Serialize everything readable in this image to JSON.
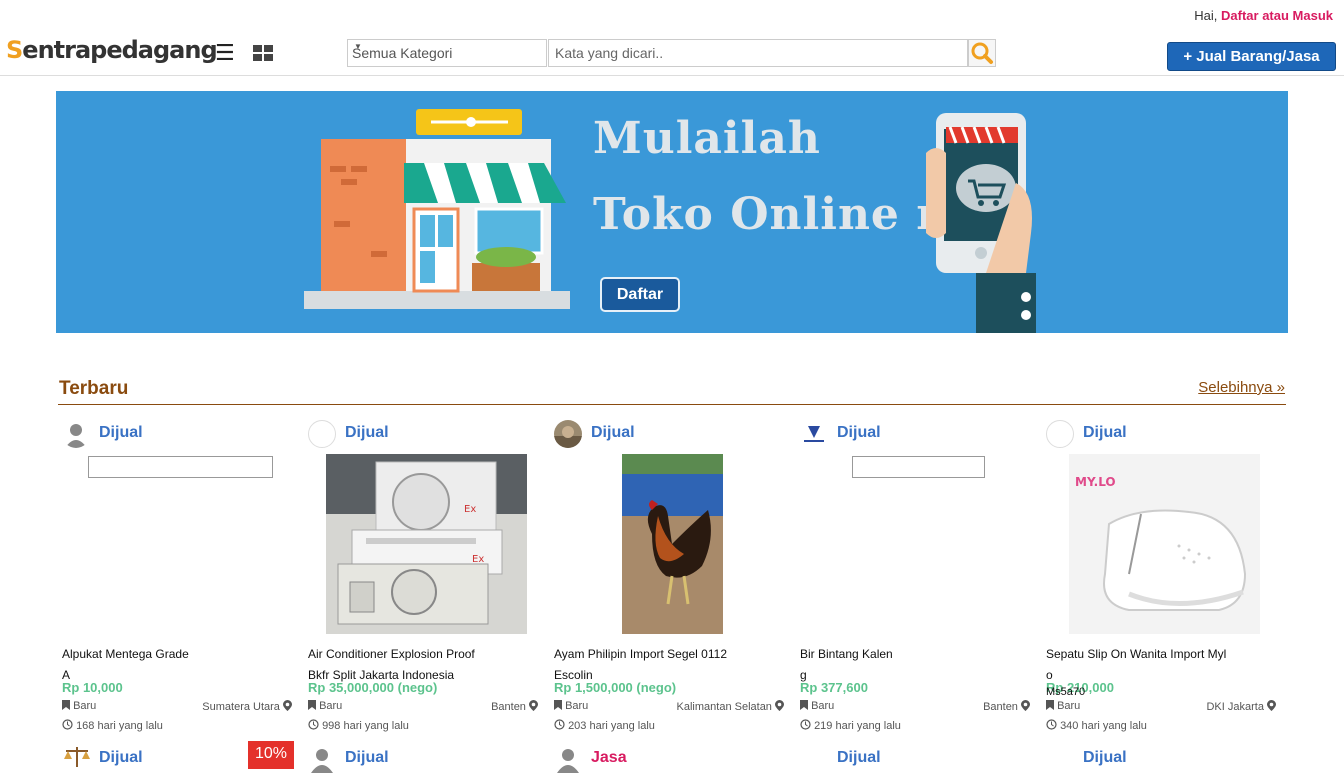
{
  "topbar": {
    "greeting": "Hai,",
    "login_link": "Daftar atau Masuk"
  },
  "header": {
    "logo_first": "S",
    "logo_rest": "entrapedagang",
    "category_value": "Semua Kategori",
    "search_placeholder": "Kata yang dicari..",
    "sell_button": "+ Jual Barang/Jasa"
  },
  "banner": {
    "line1": "Mulailah",
    "line2": "Toko Online mu..",
    "button": "Daftar"
  },
  "section": {
    "title": "Terbaru",
    "more": "Selebihnya »"
  },
  "products": [
    {
      "type": "Dijual",
      "title_line1": "Alpukat Mentega Grade",
      "title_line2": "A",
      "price": "Rp 10,000",
      "condition": "Baru",
      "location": "Sumatera Utara",
      "time": "168 hari yang lalu"
    },
    {
      "type": "Dijual",
      "title_line1": "Air Conditioner Explosion Proof",
      "title_line2": "Bkfr Split Jakarta Indonesia",
      "price": "Rp 35,000,000 (nego)",
      "condition": "Baru",
      "location": "Banten",
      "time": "998 hari yang lalu"
    },
    {
      "type": "Dijual",
      "title_line1": "Ayam Philipin Import Segel 0112",
      "title_line2": "Escolin",
      "price": "Rp 1,500,000 (nego)",
      "condition": "Baru",
      "location": "Kalimantan Selatan",
      "time": "203 hari yang lalu"
    },
    {
      "type": "Dijual",
      "title_line1": "Bir Bintang Kalen",
      "title_line2": "g",
      "price": "Rp 377,600",
      "condition": "Baru",
      "location": "Banten",
      "time": "219 hari yang lalu"
    },
    {
      "type": "Dijual",
      "title_line1": "Sepatu Slip On Wanita Import Myl",
      "title_line2": "o",
      "title_line3": "Ms5a70",
      "price": "Rp 210,000",
      "condition": "Baru",
      "location": "DKI Jakarta",
      "time": "340 hari yang lalu"
    }
  ],
  "row2": [
    {
      "type": "Dijual",
      "badge": "10%"
    },
    {
      "type": "Dijual"
    },
    {
      "type": "Jasa"
    },
    {
      "type": "Dijual"
    },
    {
      "type": "Dijual"
    }
  ],
  "product_image_labels": {
    "brand_mylo": "MY.LO",
    "ex_mark": "Ex"
  },
  "colors": {
    "accent": "#1e67b8",
    "price": "#5cc38d",
    "section": "#8a4b0f",
    "link": "#d81b60",
    "banner": "#3a98d8"
  }
}
